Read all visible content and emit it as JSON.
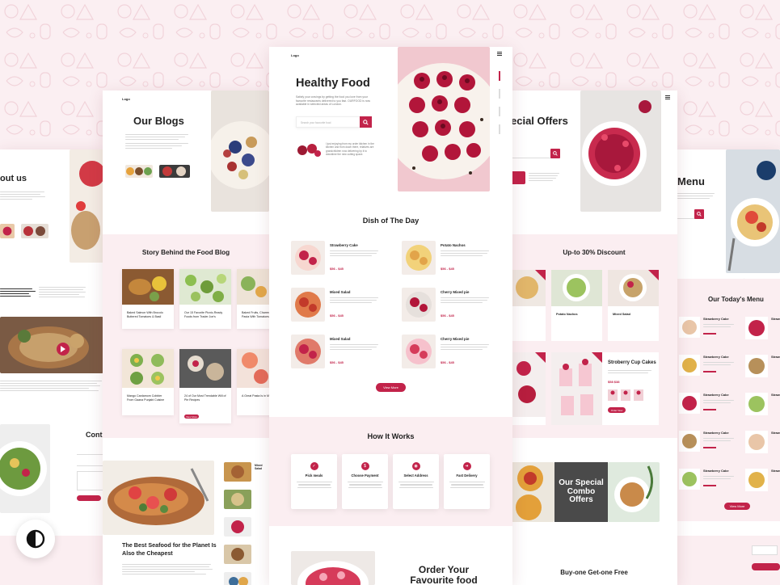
{
  "colors": {
    "accent": "#c2234a",
    "bg": "#fbeff2"
  },
  "center": {
    "logo": "Logo",
    "nav_icon": "hamburger-icon",
    "hero_title": "Healthy Food",
    "hero_sub": "Satisfy your cravings by getting the food you love from your favourite restaurants delivered to you fast. OURFOOD is now available in selected areas of London.",
    "search_placeholder": "Search your favourite food",
    "quote": "I just enjoying from my order kitchen in the kitchen and from down there, relatives are grandchildren now delivering by it to downtime the new cutting space.",
    "dish_title": "Dish of The Day",
    "dishes": [
      {
        "name": "Strawberry Cake",
        "price": "$56 - $45"
      },
      {
        "name": "Potato Nachos",
        "price": "$56 - $45"
      },
      {
        "name": "Mixed Salad",
        "price": "$56 - $45"
      },
      {
        "name": "Cherry Mixed pie",
        "price": "$56 - $45"
      },
      {
        "name": "Mixed Salad",
        "price": "$56 - $45"
      },
      {
        "name": "Cherry Mixed pie",
        "price": "$56 - $45"
      }
    ],
    "view_more": "View More",
    "how_title": "How It Works",
    "steps": [
      "Pick meals",
      "Choose Payment",
      "Select Address",
      "Fast Delivery"
    ],
    "order_title": "Order Your Favourite food"
  },
  "blog": {
    "logo": "Logo",
    "title": "Our Blogs",
    "story_title": "Story Behind the Food Blog",
    "posts": [
      "Baked Salmon With Brocolo Buttered Tomatoes & Basil",
      "Our 15 Favorite Picnic-Ready Foods from Trader Joe's",
      "Baked Fruits, Charred Sweet Pasta With Tomatoes",
      "Mango Cardamom Cobbler From Gaana Punjabi Cuisine",
      "24 of Our Most Trendable Will of Pie Recipes",
      "A Great Pasta Is in Minutes"
    ],
    "view_more": "View More",
    "seafood_title": "The Best Seafood for the Planet Is Also the Cheapest",
    "side_label": "Mixed Salad"
  },
  "offers": {
    "title": "ecial Offers",
    "discount_title": "Up-to 30% Discount",
    "items": [
      "Potato Nachos",
      "Mixed Salad",
      "Stroberry Cup Cakes"
    ],
    "cup_price": "$58 $38",
    "order_now": "Order Now",
    "combo_title": "Our Special Combo Offers",
    "bogo": "Buy-one Get-one Free"
  },
  "about": {
    "title": "out us",
    "contact": "Cont"
  },
  "menu": {
    "title": "Menu",
    "todays": "Our Today's Menu",
    "items": [
      "Strawberry Cake",
      "Strawberry Cake",
      "Strawberry Cake",
      "Strawberry Cake",
      "Strawberry Cake"
    ],
    "item_right": "Straw",
    "view_more": "View More"
  }
}
